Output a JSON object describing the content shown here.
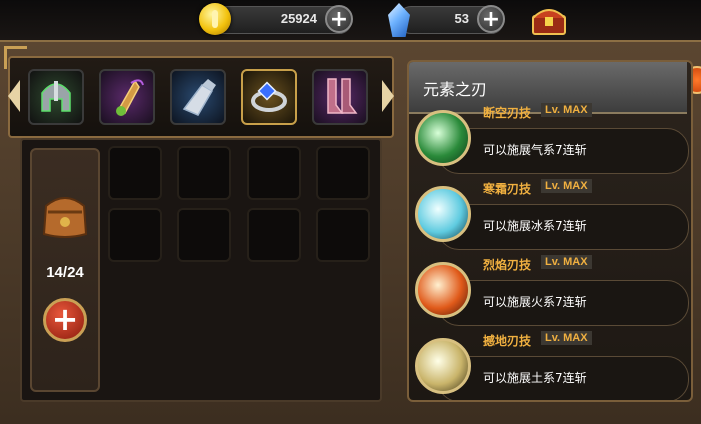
{
  "currency": {
    "gold": "25924",
    "gems": "53",
    "plus": "+"
  },
  "inventory": {
    "count": "14/24",
    "add": "+"
  },
  "skill_panel": {
    "title": "元素之刃",
    "skills": [
      {
        "name": "断空刃技",
        "level": "Lv. MAX",
        "desc": "可以施展气系7连斩",
        "color": "#4fd07a"
      },
      {
        "name": "寒霜刃技",
        "level": "Lv. MAX",
        "desc": "可以施展冰系7连斩",
        "color": "#7fe8ff"
      },
      {
        "name": "烈焰刃技",
        "level": "Lv. MAX",
        "desc": "可以施展火系7连斩",
        "color": "#ff8a3a"
      },
      {
        "name": "撼地刃技",
        "level": "Lv. MAX",
        "desc": "可以施展土系7连斩",
        "color": "#f2e7a8"
      }
    ]
  },
  "equipment": [
    "helmet-icon",
    "amulet-icon",
    "gauntlet-icon",
    "ring-icon",
    "boots-icon"
  ]
}
